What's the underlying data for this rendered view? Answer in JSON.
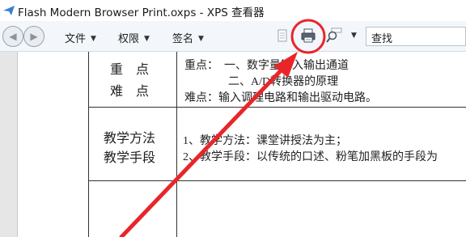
{
  "window": {
    "title": "Flash Modern Browser Print.oxps - XPS 查看器"
  },
  "toolbar": {
    "menu_file": "文件",
    "menu_permissions": "权限",
    "menu_signature": "签名",
    "search_value": "查找",
    "icons": [
      "back-icon",
      "forward-icon",
      "page-icon",
      "print-icon",
      "zoom-icon"
    ]
  },
  "document": {
    "row1": {
      "label_line1": "重　点",
      "label_line2": "难　点",
      "line1": "重点：　一、数字量输入输出通道",
      "line2": "二、A/D转换器的原理",
      "line3": "难点：输入调理电路和输出驱动电路。"
    },
    "row2": {
      "label_line1": "教学方法",
      "label_line2": "教学手段",
      "line1": "1、教学方法：课堂讲授法为主；",
      "line2": "2、教学手段：以传统的口述、粉笔加黑板的手段为"
    }
  },
  "annotation": {
    "color": "#e8262a"
  }
}
